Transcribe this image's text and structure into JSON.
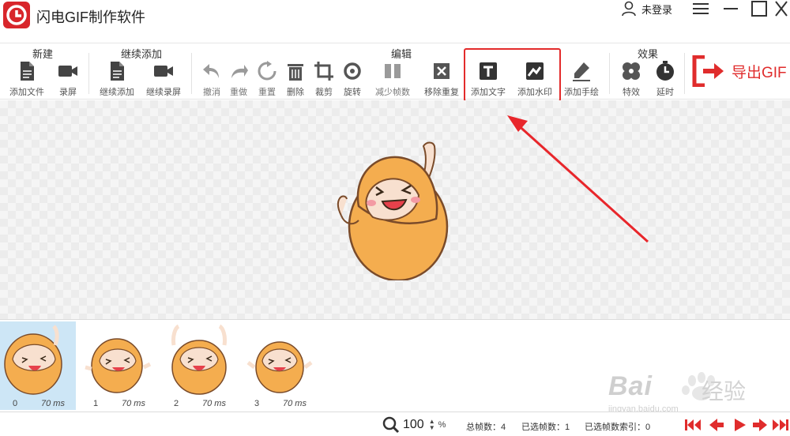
{
  "app": {
    "title": "闪电GIF制作软件",
    "user_label": "未登录"
  },
  "toolbar": {
    "groups": {
      "new": "新建",
      "continue_add": "继续添加",
      "edit": "编辑",
      "effects": "效果"
    },
    "tools": {
      "add_file": "添加文件",
      "record": "录屏",
      "continue_add": "继续添加",
      "continue_record": "继续录屏",
      "undo": "撤消",
      "redo": "重做",
      "reset": "重置",
      "delete": "删除",
      "crop": "裁剪",
      "rotate": "旋转",
      "reduce_frames": "减少帧数",
      "remove_duplicate": "移除重复",
      "add_text": "添加文字",
      "add_watermark": "添加水印",
      "add_drawing": "添加手绘",
      "effects": "特效",
      "delay": "延时"
    },
    "export_label": "导出GIF"
  },
  "frames": [
    {
      "index": "0",
      "duration": "70 ms",
      "selected": true
    },
    {
      "index": "1",
      "duration": "70 ms",
      "selected": false
    },
    {
      "index": "2",
      "duration": "70 ms",
      "selected": false
    },
    {
      "index": "3",
      "duration": "70 ms",
      "selected": false
    }
  ],
  "watermark": {
    "text": "Bai",
    "text2": "经验",
    "url": "jingyan.baidu.com"
  },
  "statusbar": {
    "zoom_value": "100",
    "zoom_unit": "%",
    "total_frames": "总帧数：4",
    "selected_frames": "已选帧数：1",
    "selected_index": "已选帧数索引：0"
  },
  "colors": {
    "accent": "#e02c2c",
    "character": "#f4ad4f",
    "selected_frame": "#cde6f6"
  }
}
